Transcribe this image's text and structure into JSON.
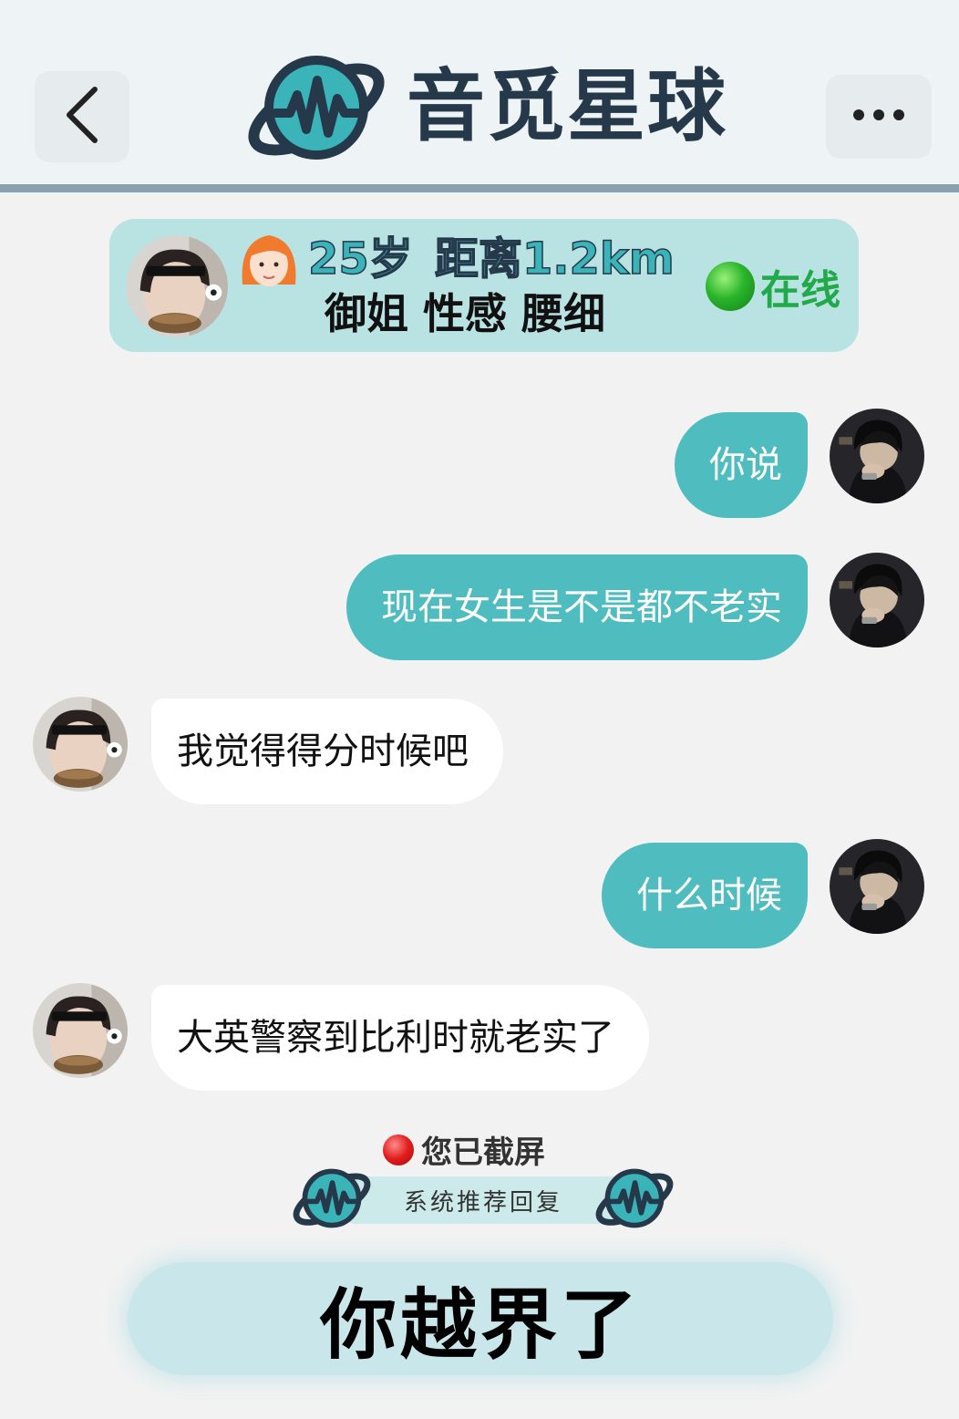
{
  "header": {
    "title": "音觅星球",
    "back_icon": "chevron-left-icon",
    "more_icon": "ellipsis-icon",
    "logo_icon": "planet-soundwave-logo"
  },
  "profile": {
    "age": "25岁",
    "distance": "距离1.2km",
    "tags": "御姐 性感 腰细",
    "status": "在线",
    "status_color": "#22a94a",
    "emoji_icon": "woman-red-hair-emoji"
  },
  "messages": [
    {
      "sender": "me",
      "text": "你说"
    },
    {
      "sender": "me",
      "text": "现在女生是不是都不老实"
    },
    {
      "sender": "them",
      "text": "我觉得得分时候吧"
    },
    {
      "sender": "me",
      "text": "什么时候"
    },
    {
      "sender": "them",
      "text": "大英警察到比利时就老实了"
    }
  ],
  "footer": {
    "screenshot_notice": "您已截屏",
    "recommend_label": "系统推荐回复",
    "suggested_reply": "你越界了"
  },
  "colors": {
    "accent_teal": "#4fbcc0",
    "card_bg": "#b9e2e3",
    "logo_dark": "#26394a",
    "reply_pill": "#c9e6ea"
  }
}
